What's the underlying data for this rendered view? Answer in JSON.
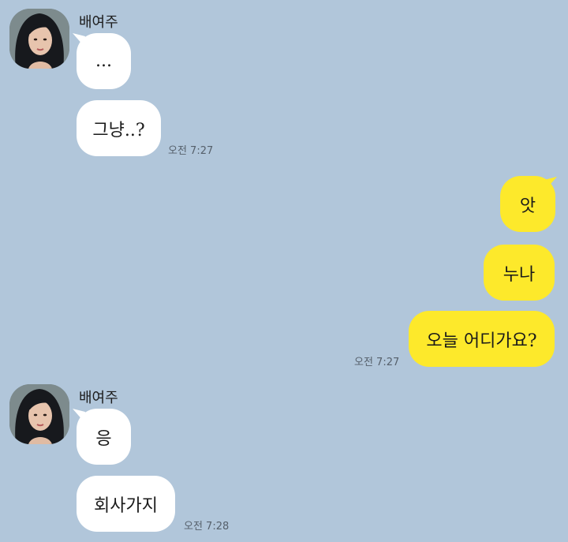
{
  "messages": {
    "group1": {
      "sender": "배여주",
      "texts": [
        "...",
        "그냥..?"
      ],
      "time": "오전 7:27"
    },
    "group2": {
      "texts": [
        "앗",
        "누나",
        "오늘 어디가요?"
      ],
      "time": "오전 7:27"
    },
    "group3": {
      "sender": "배여주",
      "texts": [
        "응",
        "회사가지"
      ],
      "time": "오전 7:28"
    }
  },
  "colors": {
    "background": "#b1c6da",
    "incoming_bubble": "#ffffff",
    "outgoing_bubble": "#fde92b"
  }
}
